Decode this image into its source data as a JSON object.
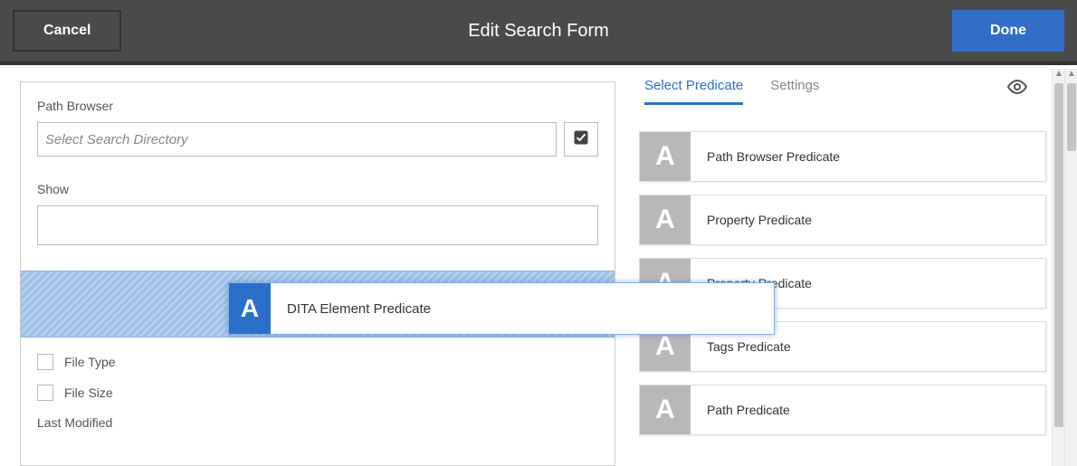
{
  "header": {
    "cancel_label": "Cancel",
    "title": "Edit Search Form",
    "done_label": "Done"
  },
  "form": {
    "path_browser_label": "Path Browser",
    "path_browser_placeholder": "Select Search Directory",
    "show_label": "Show",
    "file_type_label": "File Type",
    "file_size_label": "File Size",
    "last_modified_label": "Last Modified"
  },
  "right": {
    "tabs": {
      "select_predicate": "Select Predicate",
      "settings": "Settings"
    },
    "predicates": [
      {
        "icon": "A",
        "label": "Path Browser Predicate"
      },
      {
        "icon": "A",
        "label": "Property Predicate"
      },
      {
        "icon": "A",
        "label": "Property Predicate"
      },
      {
        "icon": "A",
        "label": "Tags Predicate"
      },
      {
        "icon": "A",
        "label": "Path Predicate"
      }
    ]
  },
  "dragging": {
    "icon": "A",
    "label": "DITA Element Predicate"
  }
}
